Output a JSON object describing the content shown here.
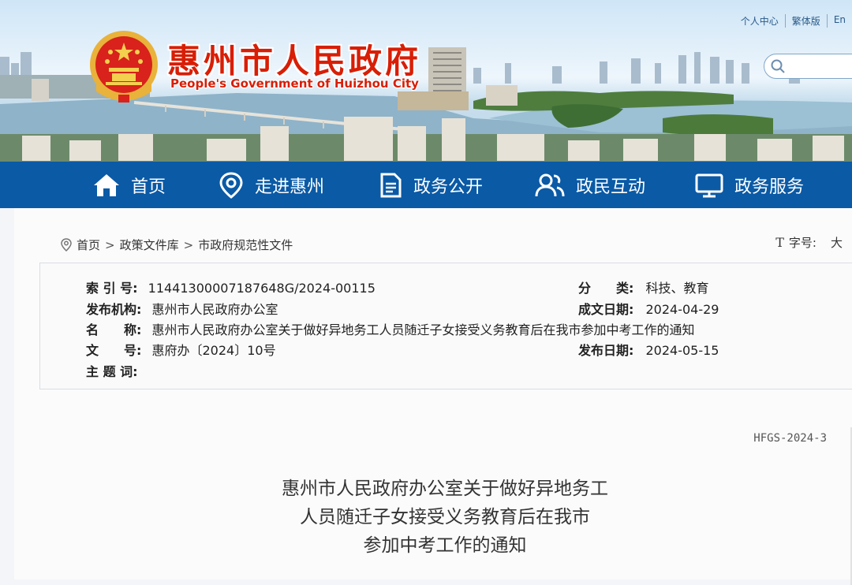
{
  "header": {
    "site_title": "惠州市人民政府",
    "site_subtitle": "People's Government of Huizhou City",
    "top_links": [
      "个人中心",
      "繁体版",
      "En"
    ],
    "emblem_icon": "national-emblem-icon",
    "search_placeholder": ""
  },
  "nav": {
    "items": [
      {
        "label": "首页",
        "icon": "home-icon"
      },
      {
        "label": "走进惠州",
        "icon": "location-pin-icon"
      },
      {
        "label": "政务公开",
        "icon": "document-icon"
      },
      {
        "label": "政民互动",
        "icon": "people-icon"
      },
      {
        "label": "政务服务",
        "icon": "monitor-icon"
      }
    ],
    "bg_color": "#0a5aa6"
  },
  "breadcrumb": {
    "items": [
      "首页",
      "政策文件库",
      "市政府规范性文件"
    ],
    "separator": ">"
  },
  "font_size": {
    "icon": "T",
    "label": "字号:",
    "option": "大"
  },
  "meta": {
    "index_label": "索 引 号:",
    "index_value": "11441300007187648G/2024-00115",
    "category_label": "分　　类:",
    "category_value": "科技、教育",
    "publisher_label": "发布机构:",
    "publisher_value": "惠州市人民政府办公室",
    "written_date_label": "成文日期:",
    "written_date_value": "2024-04-29",
    "name_label": "名　　称:",
    "name_value": "惠州市人民政府办公室关于做好异地务工人员随迁子女接受义务教育后在我市参加中考工作的通知",
    "docnum_label": "文　　号:",
    "docnum_value": "惠府办〔2024〕10号",
    "publish_date_label": "发布日期:",
    "publish_date_value": "2024-05-15",
    "keywords_label": "主 题 词:",
    "keywords_value": ""
  },
  "document": {
    "code": "HFGS-2024-3",
    "title_lines": [
      "惠州市人民政府办公室关于做好异地务工",
      "人员随迁子女接受义务教育后在我市",
      "参加中考工作的通知"
    ]
  }
}
